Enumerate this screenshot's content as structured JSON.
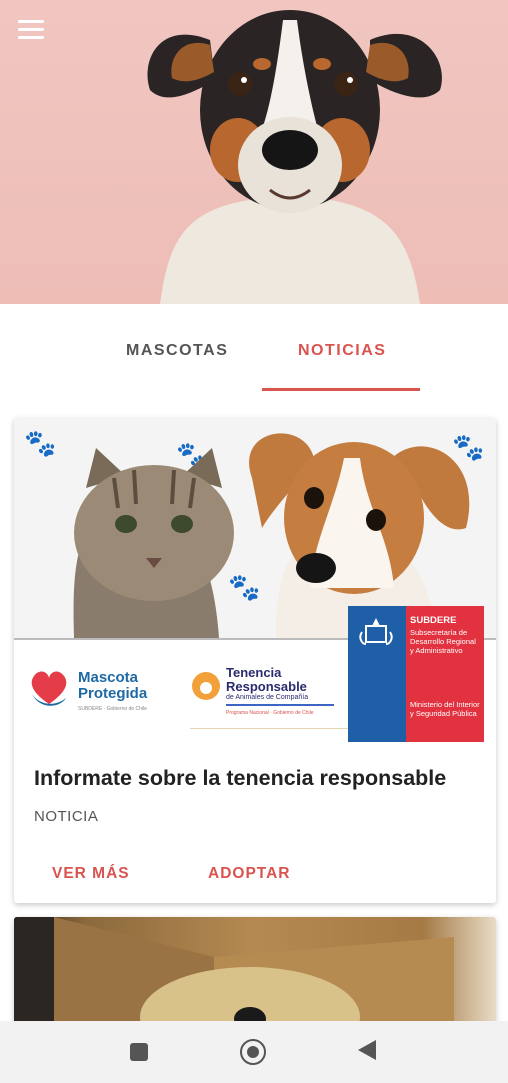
{
  "tabs": [
    {
      "label": "MASCOTAS",
      "active": false
    },
    {
      "label": "NOTICIAS",
      "active": true
    }
  ],
  "colors": {
    "accent": "#d9534f",
    "hero_bg": "#f1c6c1"
  },
  "card": {
    "title": "Informate sobre la tenencia responsable",
    "subtitle": "NOTICIA",
    "actions": [
      "VER MÁS",
      "ADOPTAR"
    ],
    "logos": {
      "mascota_title": "Mascota Protegida",
      "mascota_sub": "SUBDERE · Gobierno de Chile",
      "tenencia_title": "Tenencia Responsable",
      "tenencia_sub1": "de Animales de Compañía",
      "tenencia_sub2": "Programa Nacional · Gobierno de Chile",
      "gov_title": "SUBDERE",
      "gov_line1": "Subsecretaría de Desarrollo Regional y Administrativo",
      "gov_line2": "Ministerio del Interior y Seguridad Pública"
    }
  },
  "icons": {
    "menu": "menu-icon",
    "nav": [
      "recents-square-icon",
      "home-circle-icon",
      "back-triangle-icon"
    ]
  }
}
